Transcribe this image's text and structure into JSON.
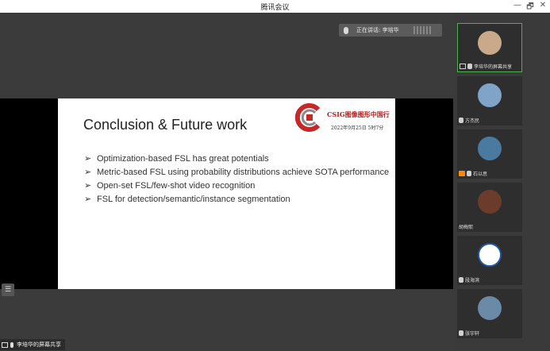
{
  "window": {
    "title": "腾讯会议",
    "controls": [
      "—",
      "🗗",
      "✕"
    ]
  },
  "speaking": {
    "label": "正在讲话: 李培华"
  },
  "slide": {
    "title": "Conclusion & Future work",
    "logo": {
      "org": "CSIG图像图形中国行",
      "date": "2022年9月25日 5时7分",
      "colors": {
        "red": "#c62828",
        "gray": "#8a8a8a"
      }
    },
    "bullets": [
      "Optimization-based FSL has great potentials",
      "Metric-based FSL using probability distributions achieve SOTA performance",
      "Open-set FSL/few-shot video recognition",
      "FSL for detection/semantic/instance segmentation"
    ],
    "bullet_glyph": "➢"
  },
  "toolbar": {
    "list_icon": "list-icon"
  },
  "share_tag": {
    "label": "李培华的屏幕共享"
  },
  "participants": [
    {
      "name": "李培华的屏幕共享",
      "icons": [
        "screen-icon",
        "mic-icon"
      ],
      "active": true,
      "avatar_color": "#c9a98a"
    },
    {
      "name": "方杰民",
      "icons": [
        "mic-icon"
      ],
      "active": false,
      "avatar_color": "#7fa4c8"
    },
    {
      "name": "石以思",
      "icons": [
        "camera-off-icon",
        "mic-icon"
      ],
      "active": false,
      "avatar_color": "#4a7aa0"
    },
    {
      "name": "胡梅熙",
      "icons": [],
      "active": false,
      "avatar_color": "#6b3b2c"
    },
    {
      "name": "段海滨",
      "icons": [
        "mic-icon"
      ],
      "active": false,
      "avatar_color": "#1e5aa0"
    },
    {
      "name": "张宇轩",
      "icons": [
        "mic-icon"
      ],
      "active": false,
      "avatar_color": "#6a8aa8"
    }
  ]
}
